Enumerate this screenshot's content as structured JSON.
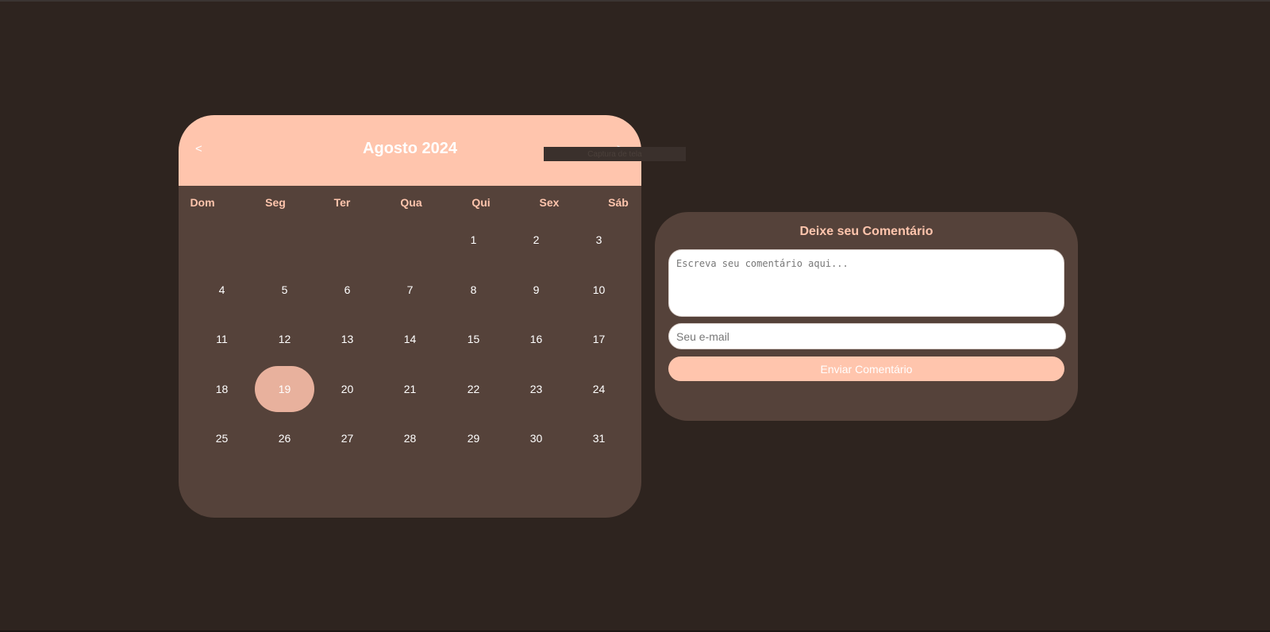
{
  "calendar": {
    "title": "Agosto 2024",
    "prev_label": "<",
    "next_label": ">",
    "weekdays": [
      "Dom",
      "Seg",
      "Ter",
      "Qua",
      "Qui",
      "Sex",
      "Sáb"
    ],
    "weeks": [
      [
        "",
        "",
        "",
        "",
        "1",
        "2",
        "3"
      ],
      [
        "4",
        "5",
        "6",
        "7",
        "8",
        "9",
        "10"
      ],
      [
        "11",
        "12",
        "13",
        "14",
        "15",
        "16",
        "17"
      ],
      [
        "18",
        "19",
        "20",
        "21",
        "22",
        "23",
        "24"
      ],
      [
        "25",
        "26",
        "27",
        "28",
        "29",
        "30",
        "31"
      ]
    ],
    "selected_day": "19",
    "colors": {
      "header": "#ffc5ad",
      "body": "#55423a",
      "selected": "#e8b19d"
    }
  },
  "capture_tip": "Captura de tela",
  "comment": {
    "title": "Deixe seu Comentário",
    "textarea_placeholder": "Escreva seu comentário aqui...",
    "email_placeholder": "Seu e-mail",
    "submit_label": "Enviar Comentário"
  },
  "colors": {
    "background": "#2e241f",
    "accent": "#ffc5ad"
  }
}
